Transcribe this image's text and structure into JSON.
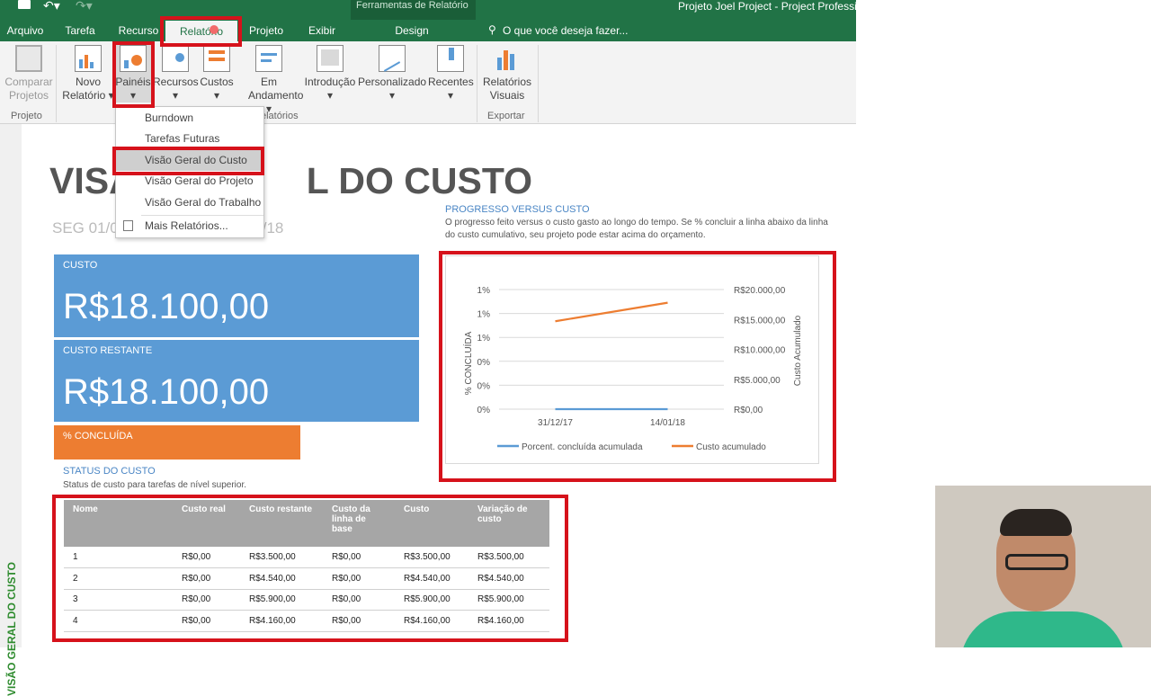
{
  "window": {
    "title": "Projeto Joel Project - Project Professio",
    "context_group": "Ferramentas de Relatório",
    "tell_me": "O que você deseja fazer..."
  },
  "tabs": [
    "Arquivo",
    "Tarefa",
    "Recurso",
    "Relatório",
    "Projeto",
    "Exibir",
    "Design"
  ],
  "ribbon": {
    "compare": [
      "Comparar",
      "Projetos"
    ],
    "group_projeto": "Projeto",
    "novo": [
      "Novo",
      "Relatório"
    ],
    "paineis": "Painéis",
    "recursos": "Recursos",
    "custos": "Custos",
    "em_andamento": [
      "Em",
      "Andamento"
    ],
    "introducao": "Introdução",
    "personalizado": "Personalizado",
    "recentes": "Recentes",
    "group_relatorios": "elatórios",
    "relatorios_visuais": [
      "Relatórios",
      "Visuais"
    ],
    "group_exportar": "Exportar"
  },
  "dropdown": {
    "items": [
      "Burndown",
      "Tarefas Futuras",
      "Visão Geral do Custo",
      "Visão Geral do Projeto",
      "Visão Geral do Trabalho"
    ],
    "more": "Mais Relatórios..."
  },
  "sidebar_label": "VISÃO GERAL DO CUSTO",
  "report": {
    "title_left": "VISÃ",
    "title_right": "L DO CUSTO",
    "date_left": "SEG 01/0",
    "date_right": "/18",
    "cost_label": "CUSTO",
    "cost_value": "R$18.100,00",
    "remaining_label": "CUSTO RESTANTE",
    "remaining_value": "R$18.100,00",
    "percent_label": "% CONCLUÍDA",
    "progress_title": "PROGRESSO VERSUS CUSTO",
    "progress_desc1": "O progresso feito versus o custo gasto ao longo do tempo. Se % concluir a linha abaixo da linha",
    "progress_desc2": "do custo cumulativo, seu projeto pode estar acima do orçamento.",
    "status_title": "STATUS DO CUSTO",
    "status_desc": "Status de custo para tarefas de nível superior."
  },
  "table": {
    "headers": [
      "Nome",
      "Custo real",
      "Custo restante",
      "Custo da linha de base",
      "Custo",
      "Variação de custo"
    ],
    "rows": [
      [
        "1",
        "R$0,00",
        "R$3.500,00",
        "R$0,00",
        "R$3.500,00",
        "R$3.500,00"
      ],
      [
        "2",
        "R$0,00",
        "R$4.540,00",
        "R$0,00",
        "R$4.540,00",
        "R$4.540,00"
      ],
      [
        "3",
        "R$0,00",
        "R$5.900,00",
        "R$0,00",
        "R$5.900,00",
        "R$5.900,00"
      ],
      [
        "4",
        "R$0,00",
        "R$4.160,00",
        "R$0,00",
        "R$4.160,00",
        "R$4.160,00"
      ]
    ]
  },
  "chart_data": {
    "type": "line",
    "x": [
      "31/12/17",
      "14/01/18"
    ],
    "y_left_ticks": [
      "1%",
      "1%",
      "1%",
      "0%",
      "0%",
      "0%"
    ],
    "y_right_ticks": [
      "R$20.000,00",
      "R$15.000,00",
      "R$10.000,00",
      "R$5.000,00",
      "R$0,00"
    ],
    "ylabel_left": "% CONCLUÍDA",
    "ylabel_right": "Custo Acumulado",
    "ylim_right": [
      0,
      20000
    ],
    "series": [
      {
        "name": "Porcent. concluída acumulada",
        "axis": "left",
        "values": [
          0,
          0
        ],
        "color": "#5b9bd5"
      },
      {
        "name": "Custo acumulado",
        "axis": "right",
        "values": [
          14700,
          17800
        ],
        "color": "#ed7d31"
      }
    ],
    "legend": "bottom",
    "grid": true
  },
  "colors": {
    "ribbon_green": "#217346",
    "card_blue": "#5b9bd5",
    "card_orange": "#ed7d31",
    "highlight_red": "#d6121b",
    "table_header": "#a6a6a6"
  }
}
